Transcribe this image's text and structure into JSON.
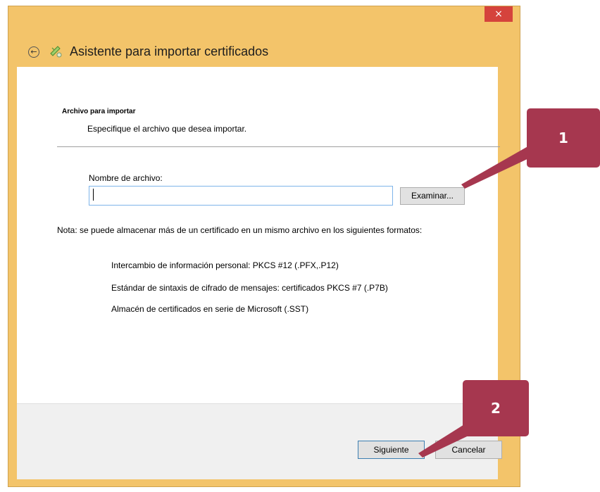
{
  "window": {
    "title": "Asistente para importar certificados",
    "close_glyph": "×",
    "back_glyph": "←"
  },
  "section": {
    "title": "Archivo para importar",
    "subtitle": "Especifique el archivo que desea importar."
  },
  "file": {
    "label": "Nombre de archivo:",
    "value": "",
    "browse_label": "Examinar..."
  },
  "note": {
    "text": "Nota: se puede almacenar más de un certificado en un mismo archivo en los siguientes formatos:",
    "formats": [
      "Intercambio de información personal: PKCS #12 (.PFX,.P12)",
      "Estándar de sintaxis de cifrado de mensajes: certificados PKCS #7 (.P7B)",
      "Almacén de certificados en serie de Microsoft (.SST)"
    ]
  },
  "footer": {
    "next_label": "Siguiente",
    "cancel_label": "Cancelar"
  },
  "callouts": [
    {
      "label": "1"
    },
    {
      "label": "2"
    }
  ],
  "colors": {
    "window_frame": "#f3c46a",
    "close_button": "#d5433c",
    "callout": "#a6374f",
    "input_border": "#7eb4ea"
  }
}
